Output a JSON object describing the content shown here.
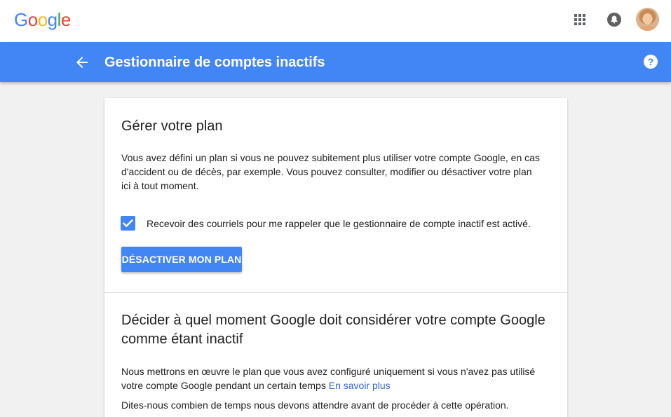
{
  "header": {
    "logo_letters": [
      {
        "char": "G",
        "color": "#4285f4"
      },
      {
        "char": "o",
        "color": "#ea4335"
      },
      {
        "char": "o",
        "color": "#fbbc05"
      },
      {
        "char": "g",
        "color": "#4285f4"
      },
      {
        "char": "l",
        "color": "#34a853"
      },
      {
        "char": "e",
        "color": "#ea4335"
      }
    ],
    "icons": {
      "apps": "apps-grid-icon",
      "notifications": "bell-icon",
      "account": "avatar"
    }
  },
  "appbar": {
    "title": "Gestionnaire de comptes inactifs",
    "back_icon": "arrow-back-icon",
    "help_icon": "help-icon",
    "color": "#4285f4"
  },
  "plan": {
    "title": "Gérer votre plan",
    "description": "Vous avez défini un plan si vous ne pouvez subitement plus utiliser votre compte Google, en cas d'accident ou de décès, par exemple. Vous pouvez consulter, modifier ou désactiver votre plan ici à tout moment.",
    "reminder_checkbox_label": "Recevoir des courriels pour me rappeler que le gestionnaire de compte inactif est activé.",
    "reminder_checked": true,
    "deactivate_button": "DÉSACTIVER MON PLAN"
  },
  "timeout": {
    "title": "Décider à quel moment Google doit considérer votre compte Google comme étant inactif",
    "description": "Nous mettrons en œuvre le plan que vous avez configuré uniquement si vous n'avez pas utilisé votre compte Google pendant un certain temps",
    "learn_more": "En savoir plus",
    "wait_question": "Dites-nous combien de temps nous devons attendre avant de procéder à cette opération."
  }
}
